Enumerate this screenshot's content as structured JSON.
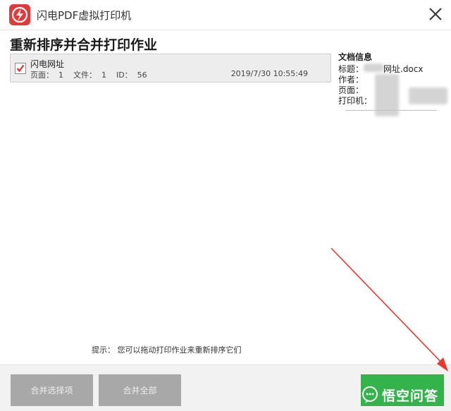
{
  "window": {
    "title": "闪电PDF虚拟打印机",
    "logo_icon": "lightning-app-logo-icon",
    "close_icon": "close-icon",
    "brand_color": "#e03a3a"
  },
  "main": {
    "heading": "重新排序并合并打印作业",
    "jobs": [
      {
        "name": "闪电网址",
        "checked": true,
        "meta": "页面：  1    文件：  1    ID：  56",
        "date": "2019/7/30 10:55:49"
      }
    ],
    "hint": "提示：  您可以拖动打印作业来重新排序它们"
  },
  "doc_info": {
    "title": "文档信息",
    "labels": {
      "title_label": "标题：",
      "author_label": "作者：",
      "pages_label": "页面：",
      "printer_label": "打印机："
    },
    "title_value": "网址.docx"
  },
  "footer": {
    "merge_selected": "合并选择项",
    "merge_all": "合并全部",
    "ok_color": "#33b34a",
    "disabled_color": "#a8a8a8"
  },
  "overlay": {
    "arrow_color": "#e8372d",
    "watermark_text": "悟空问答",
    "watermark_icon": "chat-bubble-icon"
  }
}
